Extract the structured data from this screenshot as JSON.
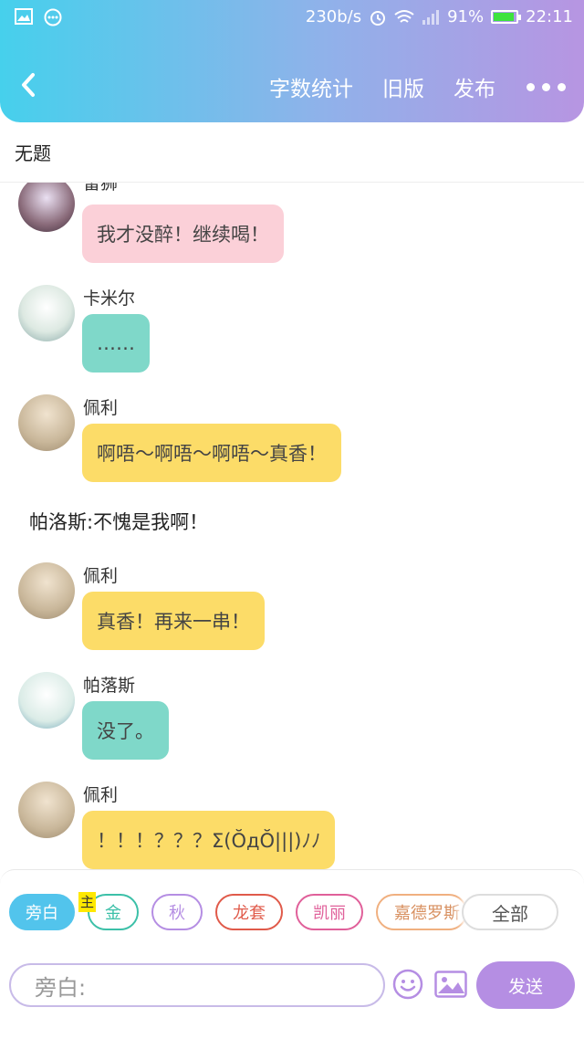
{
  "status_bar": {
    "speed": "230b/s",
    "signal": "ıll",
    "battery_percent": "91%",
    "battery_level": 0.91,
    "time": "22:11"
  },
  "nav": {
    "word_count": "字数统计",
    "old_version": "旧版",
    "publish": "发布"
  },
  "topic_title": "无题",
  "messages": [
    {
      "name": "雷狮",
      "text": "我才没醉！继续喝！",
      "color": "#fbd0d8"
    },
    {
      "name": "卡米尔",
      "text": "……",
      "color": "#7fd8c9"
    },
    {
      "name": "佩利",
      "text": "啊唔～啊唔～啊唔～真香！",
      "color": "#fcdc68"
    },
    {
      "narration": "帕洛斯:不愧是我啊！"
    },
    {
      "name": "佩利",
      "text": "真香！再来一串！",
      "color": "#fcdc68"
    },
    {
      "name": "帕落斯",
      "text": "没了。",
      "color": "#7fd8c9"
    },
    {
      "name": "佩利",
      "text": "！！！？？？Σ(ŎдŎ|||)ﾉﾉ",
      "color": "#fcdc68"
    }
  ],
  "roles": {
    "narrator": "旁白",
    "host_tag": "主",
    "items": [
      {
        "label": "金",
        "color": "#3cc0a8"
      },
      {
        "label": "秋",
        "color": "#b58ee3"
      },
      {
        "label": "龙套",
        "color": "#e05a4a"
      },
      {
        "label": "凯丽",
        "color": "#e0609a"
      },
      {
        "label": "嘉德罗斯",
        "color": "#f0b080"
      }
    ],
    "all": "全部"
  },
  "composer": {
    "placeholder": "旁白:",
    "send": "发送"
  },
  "colors": {
    "header_start": "#46d0ec",
    "header_end": "#b795e2",
    "send_button": "#b58ee3"
  }
}
